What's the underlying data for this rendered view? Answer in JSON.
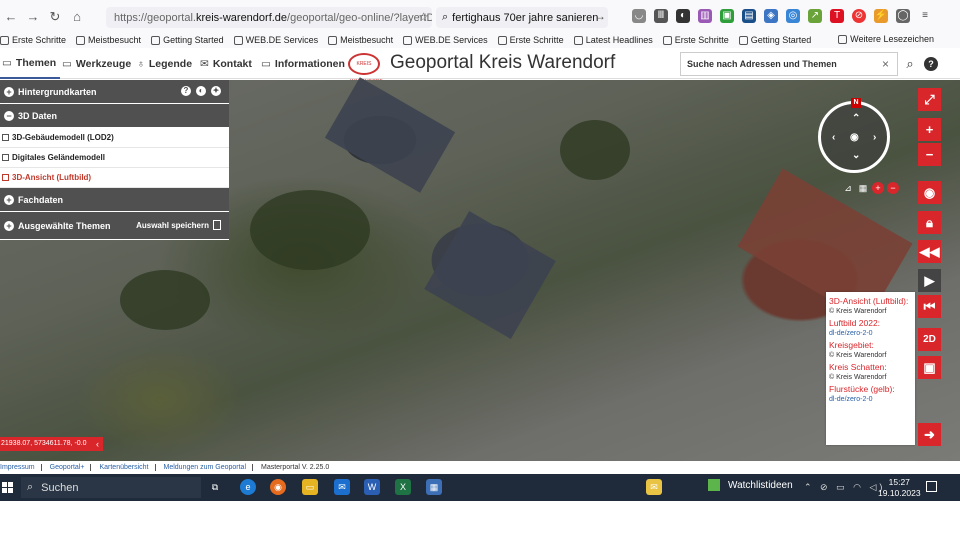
{
  "browser": {
    "url_prefix": "https://geoportal.",
    "url_host": "kreis-warendorf.de",
    "url_rest": "/geoportal/geo-online/?layerIDs",
    "search_query": "fertighaus 70er jahre sanieren",
    "bookmarks": [
      "Erste Schritte",
      "Meistbesucht",
      "Getting Started",
      "WEB.DE Services",
      "Meistbesucht",
      "WEB.DE Services",
      "Erste Schritte",
      "Latest Headlines",
      "Erste Schritte",
      "Getting Started"
    ],
    "bookmarks_right": "Weitere Lesezeichen"
  },
  "header": {
    "menu": [
      "Themen",
      "Werkzeuge",
      "Legende",
      "Kontakt",
      "Informationen"
    ],
    "logo_text": "KREIS WARENDORF",
    "title": "Geoportal Kreis Warendorf",
    "search_placeholder": "Suche nach Adressen und Themen",
    "help": "?"
  },
  "panel": {
    "hintergrund": "Hintergrundkarten",
    "daten3d": "3D Daten",
    "layers": [
      "3D-Gebäudemodell (LOD2)",
      "Digitales Geländemodell",
      "3D-Ansicht (Luftbild)"
    ],
    "fachdaten": "Fachdaten",
    "ausgewaehlt": "Ausgewählte Themen",
    "auswahl_speichern": "Auswahl speichern"
  },
  "map": {
    "compass_n": "N",
    "mode_2d": "2D",
    "coordinates": "21938.07, 5734611.78, -0.0"
  },
  "attribution": [
    {
      "title": "3D-Ansicht (Luftbild):",
      "credit": "© Kreis Warendorf",
      "link": false
    },
    {
      "title": "Luftbild 2022:",
      "credit": "dl-de/zero-2-0",
      "link": true
    },
    {
      "title": "Kreisgebiet:",
      "credit": "© Kreis Warendorf",
      "link": false
    },
    {
      "title": "Kreis Schatten:",
      "credit": "© Kreis Warendorf",
      "link": false
    },
    {
      "title": "Flurstücke (gelb):",
      "credit": "dl-de/zero-2-0",
      "link": true
    }
  ],
  "footer": [
    "Impressum",
    "Geoportal+",
    "Kartenübersicht",
    "Meldungen zum Geoportal",
    "Masterportal V. 2.25.0"
  ],
  "taskbar": {
    "search": "Suchen",
    "watchlist": "Watchlistideen",
    "time": "15:27",
    "date": "19.10.2023"
  },
  "colors": {
    "accent": "#d9262b",
    "panel_head": "#505050",
    "link": "#2960a8"
  }
}
